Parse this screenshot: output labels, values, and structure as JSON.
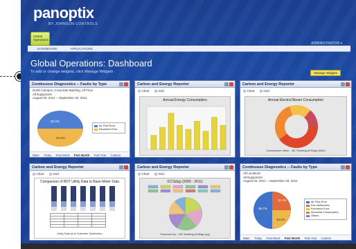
{
  "brand": {
    "logo": "panoptix",
    "tagline": "BY JOHNSON CONTROLS"
  },
  "category_tab": {
    "label": "Global Operations"
  },
  "nav": {
    "items": [
      "DASHBOARD",
      "APPLICATIONS"
    ]
  },
  "account_link": "ADMINISTRATOR ▾",
  "page": {
    "title": "Global Operations: Dashboard",
    "subtitle": "To add or change widgets, click Manage Widgets",
    "manage_button": "Manage Widgets"
  },
  "widgets": [
    {
      "title": "Continuous Diagnostics -- Faults by Type",
      "info": [
        "North Campus, Corporate Building, All Floor",
        "All Equipment",
        "August 03, 2011 -- September 03, 2011"
      ],
      "pie_labels": [
        "60.0%",
        "40.0%"
      ],
      "legend": [
        "Air Flow Error",
        "Excessive Error"
      ],
      "colors": [
        "#4f7fd0",
        "#f0b84a"
      ],
      "footer": {
        "date": "Date:",
        "links": [
          "Today",
          "Past Week",
          "Past Month",
          "Past Year",
          "Custom"
        ],
        "selected": "Past Month"
      }
    },
    {
      "title": "Carbon and Energy Reporter",
      "tabs": [
        "Chart",
        "Grid"
      ],
      "chart_title": "Annual Energy Consumption",
      "y_axis": "Consumption (kWh)",
      "bars": [
        0.35,
        0.55,
        0.9,
        0.6,
        0.5,
        0.7,
        0.45,
        0.8,
        0.6
      ]
    },
    {
      "title": "Carbon and Energy Reporter",
      "tabs": [
        "Chart",
        "Grid"
      ],
      "chart_title": "Annual Electric/Steam Consumption",
      "caption": "Consumption Value -- BLT Building All Bldgs (kWh)"
    },
    {
      "title": "Carbon and Energy Reporter",
      "tabs": [
        "Chart",
        "Grid"
      ],
      "chart_title": "Comparison of BDT Utility Data to Base Meter Data",
      "caption": "Utility Data as to Submeter Distribution"
    },
    {
      "title": "Carbon and Energy Reporter",
      "tabs": [
        "Chart",
        "Grid"
      ],
      "chart_title": "ICCS(kg) (2000 - 2011)",
      "caption": "Presented by -- BLT Building All Bldgs (kg)"
    },
    {
      "title": "Continuous Diagnostics -- Faults by Type",
      "info": [
        "All Locations",
        "All Equipment",
        "August 03, 2011 -- September 03, 2011"
      ],
      "pie_labels": [
        "36.7%",
        "11.1%",
        "45.5%"
      ],
      "legend": [
        "Air Flow Error",
        "Fan Malfunction",
        "Excessive Error",
        "Abnormal Consumption",
        "Others"
      ],
      "colors": [
        "#3f73c9",
        "#e36a3a",
        "#f0b84a",
        "#6fb24a",
        "#9b6bc2"
      ],
      "footer": {
        "date": "Date:",
        "links": [
          "Today",
          "Past Week",
          "Past Month",
          "Past Year",
          "Custom"
        ],
        "selected": "Past Month"
      }
    }
  ]
}
